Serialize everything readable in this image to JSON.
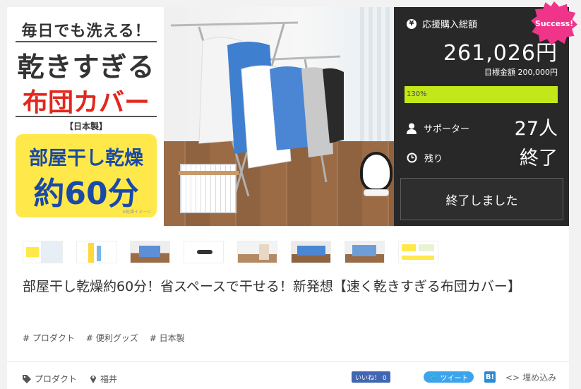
{
  "hero": {
    "line1": "毎日でも洗える！",
    "line2": "乾きすぎる",
    "line3": "布団カバー",
    "line4": "【日本製】",
    "line5": "部屋干し乾燥",
    "line6": "約60分",
    "caption": "※乾燥イメージ"
  },
  "funding": {
    "badge": "Success!",
    "total_label": "応援購入総額",
    "total_value": "261,026円",
    "goal_text": "目標金額 200,000円",
    "progress_percent": 130,
    "progress_label": "130%",
    "supporters_label": "サポーター",
    "supporters_value": "27人",
    "remaining_label": "残り",
    "remaining_value": "終了",
    "ended_button": "終了しました",
    "accent": "#c3e81a",
    "badge_color": "#f0348a"
  },
  "project": {
    "title": "部屋干し乾燥約60分！省スペースで干せる！新発想【速く乾きすぎる布団カバー】",
    "tags": [
      "# プロダクト",
      "# 便利グッズ",
      "# 日本製"
    ],
    "category": "プロダクト",
    "location": "福井"
  },
  "share": {
    "facebook": "いいね！ 0",
    "twitter": "ツイート",
    "hatena": "B!",
    "embed": "埋め込み"
  }
}
